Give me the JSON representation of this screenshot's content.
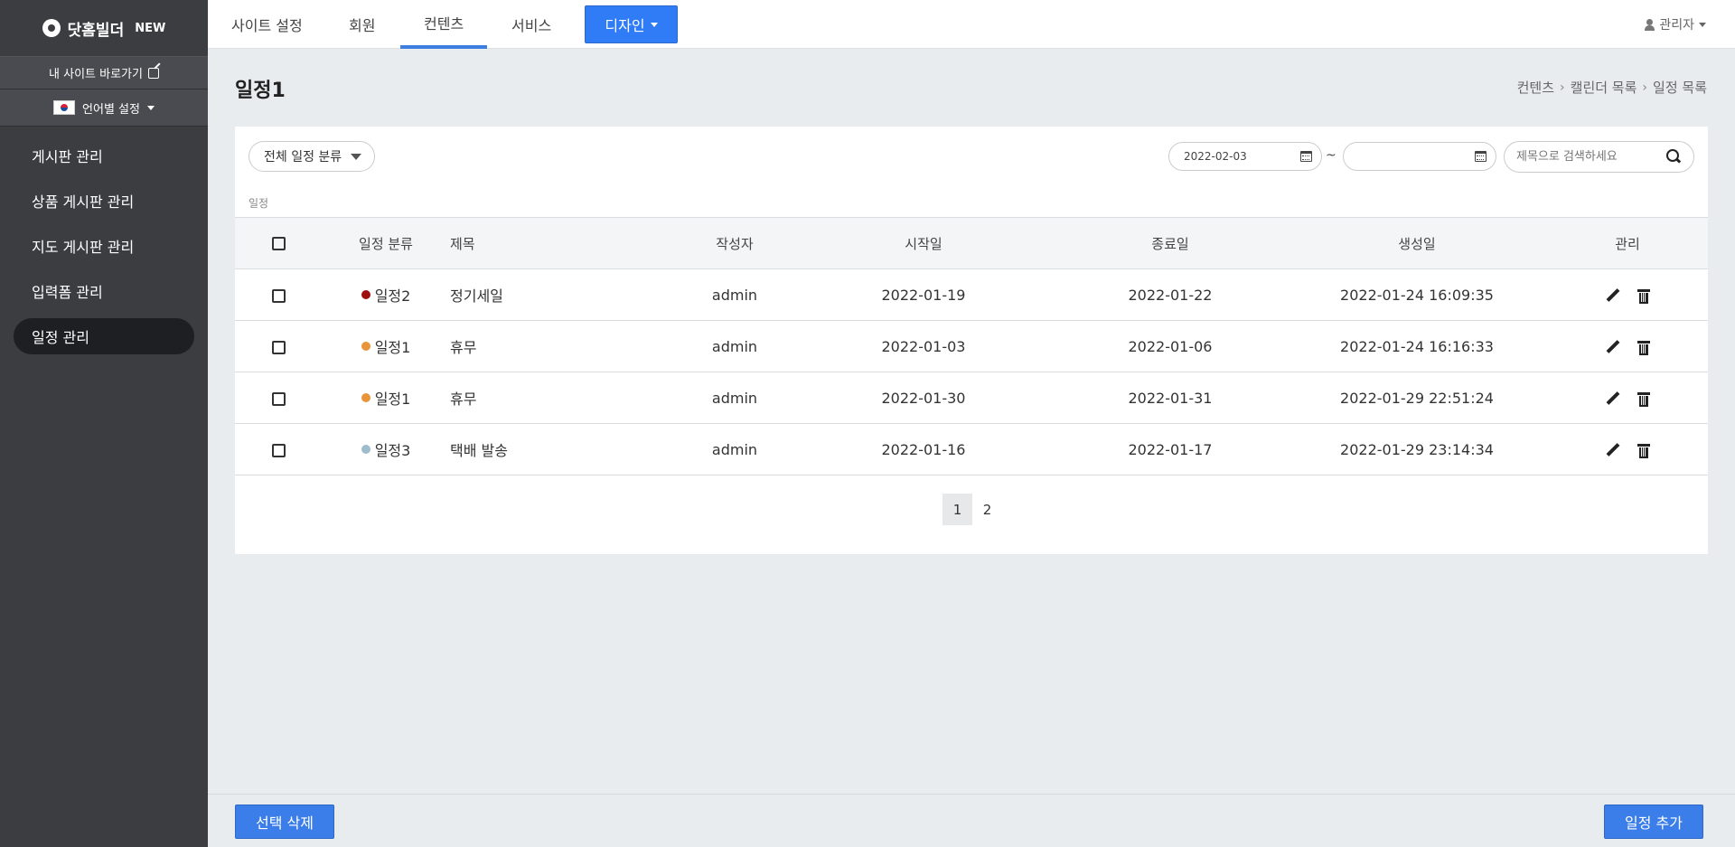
{
  "sidebar": {
    "logo_text": "닷홈빌더",
    "logo_badge": "NEW",
    "site_link": "내 사이트 바로가기",
    "language": "언어별 설정",
    "items": [
      {
        "label": "게시판 관리"
      },
      {
        "label": "상품 게시판 관리"
      },
      {
        "label": "지도 게시판 관리"
      },
      {
        "label": "입력폼 관리"
      },
      {
        "label": "일정 관리"
      }
    ]
  },
  "topnav": {
    "tabs": [
      {
        "label": "사이트 설정"
      },
      {
        "label": "회원"
      },
      {
        "label": "컨텐츠"
      },
      {
        "label": "서비스"
      }
    ],
    "design_label": "디자인",
    "user_label": "관리자"
  },
  "page": {
    "title": "일정1",
    "breadcrumb": [
      "컨텐츠",
      "캘린더 목록",
      "일정 목록"
    ]
  },
  "filters": {
    "category_label": "전체 일정 분류",
    "start_date": "2022-02-03",
    "end_date": "",
    "tilde": "~",
    "search_placeholder": "제목으로 검색하세요",
    "section_label": "일정"
  },
  "table": {
    "headers": [
      "일정 분류",
      "제목",
      "작성자",
      "시작일",
      "종료일",
      "생성일",
      "관리"
    ],
    "rows": [
      {
        "category": "일정2",
        "color": "#a00f0f",
        "title": "정기세일",
        "author": "admin",
        "start": "2022-01-19",
        "end": "2022-01-22",
        "created": "2022-01-24 16:09:35"
      },
      {
        "category": "일정1",
        "color": "#e8943a",
        "title": "휴무",
        "author": "admin",
        "start": "2022-01-03",
        "end": "2022-01-06",
        "created": "2022-01-24 16:16:33"
      },
      {
        "category": "일정1",
        "color": "#e8943a",
        "title": "휴무",
        "author": "admin",
        "start": "2022-01-30",
        "end": "2022-01-31",
        "created": "2022-01-29 22:51:24"
      },
      {
        "category": "일정3",
        "color": "#9fbccc",
        "title": "택배 발송",
        "author": "admin",
        "start": "2022-01-16",
        "end": "2022-01-17",
        "created": "2022-01-29 23:14:34"
      }
    ]
  },
  "pagination": {
    "pages": [
      "1",
      "2"
    ],
    "current": "1"
  },
  "footer": {
    "delete_label": "선택 삭제",
    "add_label": "일정 추가"
  }
}
